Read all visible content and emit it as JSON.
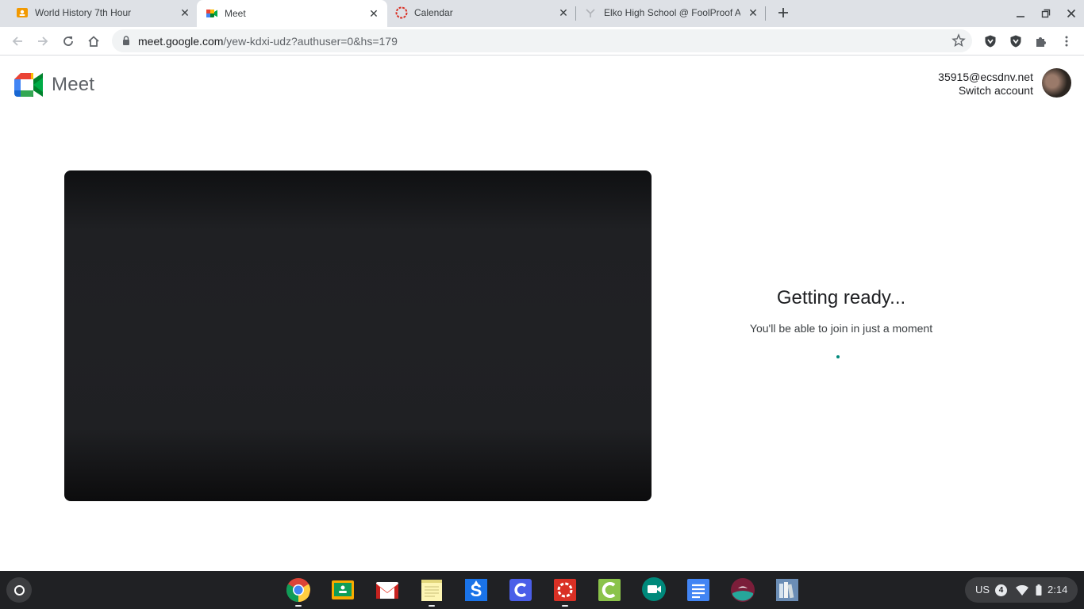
{
  "tabs": [
    {
      "title": "World History 7th Hour",
      "icon": "classroom-icon"
    },
    {
      "title": "Meet",
      "icon": "meet-icon"
    },
    {
      "title": "Calendar",
      "icon": "calendar-icon"
    },
    {
      "title": "Elko High School @ FoolProof A",
      "icon": "foolproof-icon"
    }
  ],
  "address_bar": {
    "host": "meet.google.com",
    "path": "/yew-kdxi-udz?authuser=0&hs=179"
  },
  "meet": {
    "app_name": "Meet",
    "account_email": "35915@ecsdnv.net",
    "switch_account_label": "Switch account",
    "status_title": "Getting ready...",
    "status_subtitle": "You'll be able to join in just a moment"
  },
  "shelf": {
    "apps": [
      "chrome-icon",
      "classroom-icon",
      "gmail-icon",
      "notes-icon",
      "s-app-icon",
      "c-app-icon",
      "cambium-icon",
      "c-green-app-icon",
      "meet-icon",
      "docs-icon",
      "bird-app-icon",
      "books-app-icon"
    ],
    "input_method": "US",
    "notification_count": "4",
    "time": "2:14"
  },
  "colors": {
    "tabstrip": "#dee1e6",
    "shelf": "#202124",
    "video_preview": "#202124",
    "spinner": "#00897b"
  }
}
